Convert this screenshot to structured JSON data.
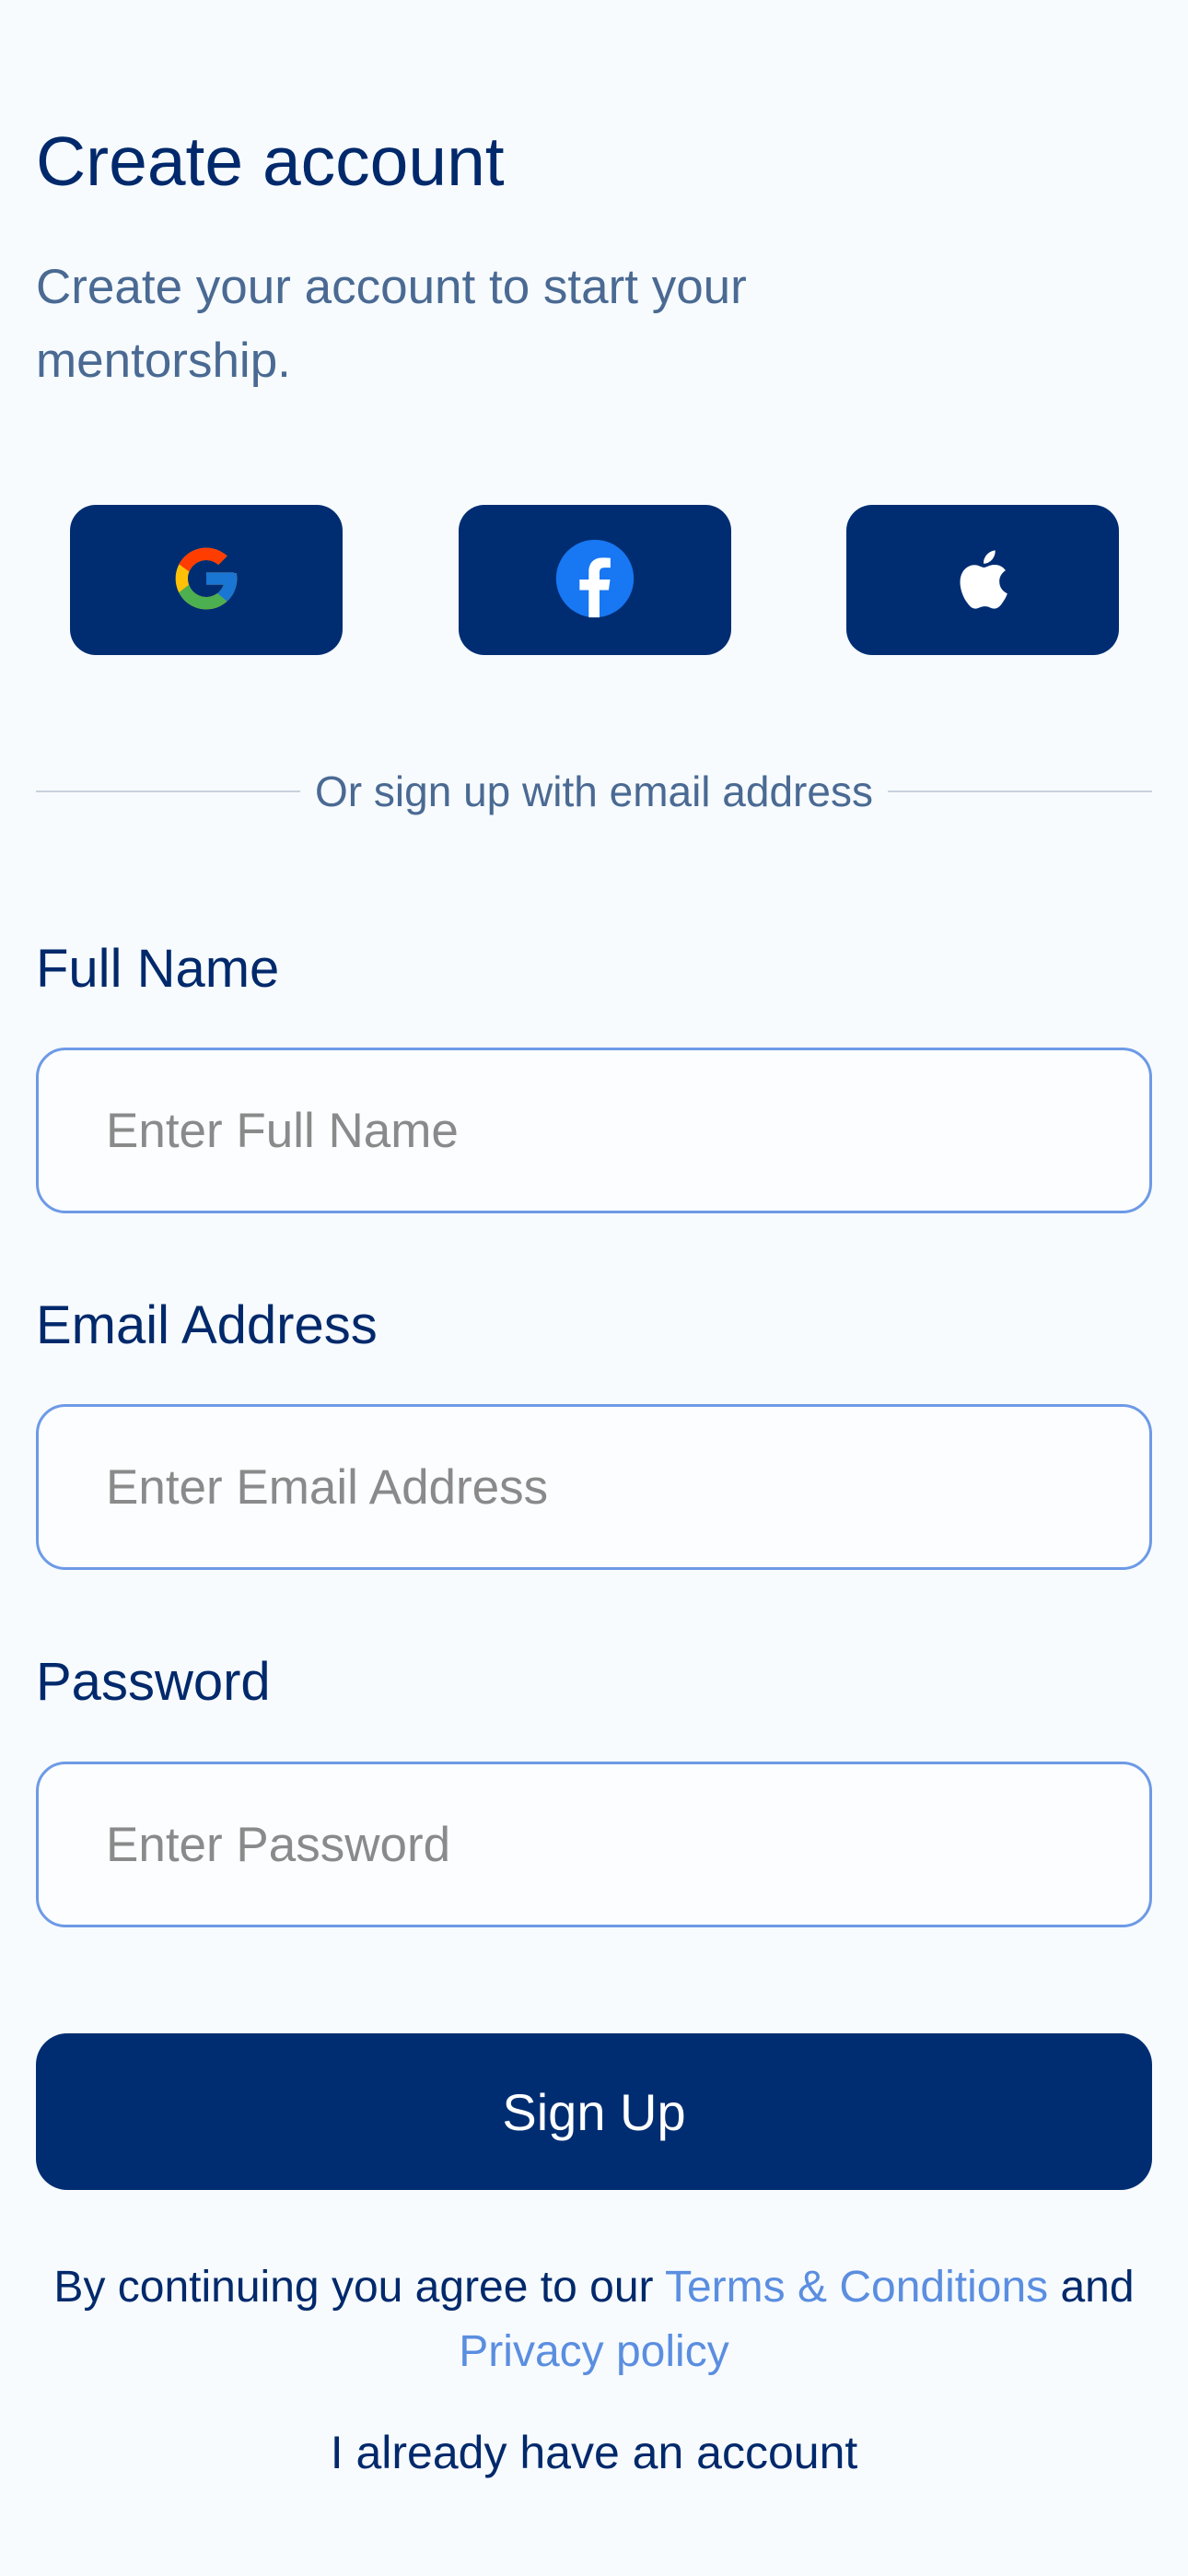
{
  "header": {
    "title": "Create account",
    "subtitle": "Create your account to start your mentorship."
  },
  "social": {
    "buttons": [
      {
        "icon": "google-icon"
      },
      {
        "icon": "facebook-icon"
      },
      {
        "icon": "apple-icon"
      }
    ]
  },
  "divider_text": "Or sign up with email address",
  "form": {
    "full_name": {
      "label": "Full Name",
      "placeholder": "Enter Full Name",
      "value": ""
    },
    "email": {
      "label": "Email Address",
      "placeholder": "Enter Email Address",
      "value": ""
    },
    "password": {
      "label": "Password",
      "placeholder": "Enter Password",
      "value": ""
    },
    "submit_label": "Sign Up"
  },
  "terms": {
    "prefix": "By continuing you agree to our ",
    "terms_link": "Terms & Conditions",
    "middle": " and ",
    "privacy_link": "Privacy policy"
  },
  "login_link": "I already have an account",
  "colors": {
    "background": "#f7fbfe",
    "primary": "#002d72",
    "link": "#5b8ee0",
    "input_border": "#6d9ae6",
    "muted_text": "#4a6a93"
  }
}
